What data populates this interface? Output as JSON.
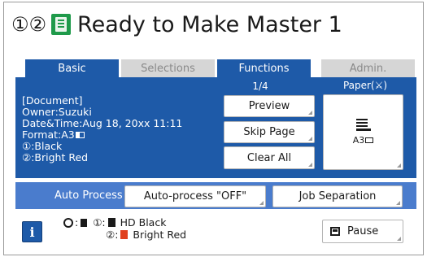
{
  "header": {
    "drum_indicators": "①②",
    "icon": "master-making-icon",
    "title": "Ready to Make Master 1"
  },
  "tabs": [
    {
      "label": "Basic",
      "state": "active"
    },
    {
      "label": "Selections",
      "state": "disabled"
    },
    {
      "label": "Functions",
      "state": "active"
    },
    {
      "label": "Admin.",
      "state": "disabled"
    }
  ],
  "document": {
    "heading": "[Document]",
    "owner": "Owner:Suzuki",
    "datetime": "Date&Time:Aug 18, 20xx 11:11",
    "format": "Format:A3",
    "format_icon": "landscape-orientation-icon",
    "color1": "①:Black",
    "color2": "②:Bright Red"
  },
  "pages": "1/4",
  "buttons": {
    "preview": "Preview",
    "skip_page": "Skip Page",
    "clear_all": "Clear All",
    "auto_process": "Auto-process \"OFF\"",
    "job_separation": "Job Separation",
    "pause": "Pause"
  },
  "paper": {
    "label": "Paper(⚔)",
    "icon": "paper-tray-icon",
    "size": "A3",
    "orientation_icon": "landscape-orientation-icon"
  },
  "auto_process_label": "Auto Process",
  "status": {
    "drum_icon": "drum-icon",
    "row1_prefix": ":",
    "drum1_label": "①:",
    "drum1_ink": "HD Black",
    "drum2_label": "②:",
    "drum2_ink": "Bright Red"
  },
  "colors": {
    "primary_blue": "#1e5aa8",
    "auto_bar_blue": "#4a7ccd",
    "disabled_tab": "#d6d6d6",
    "ink_black": "#1a1a1a",
    "ink_red": "#e0401e",
    "title_icon_green": "#1f9a4a"
  }
}
